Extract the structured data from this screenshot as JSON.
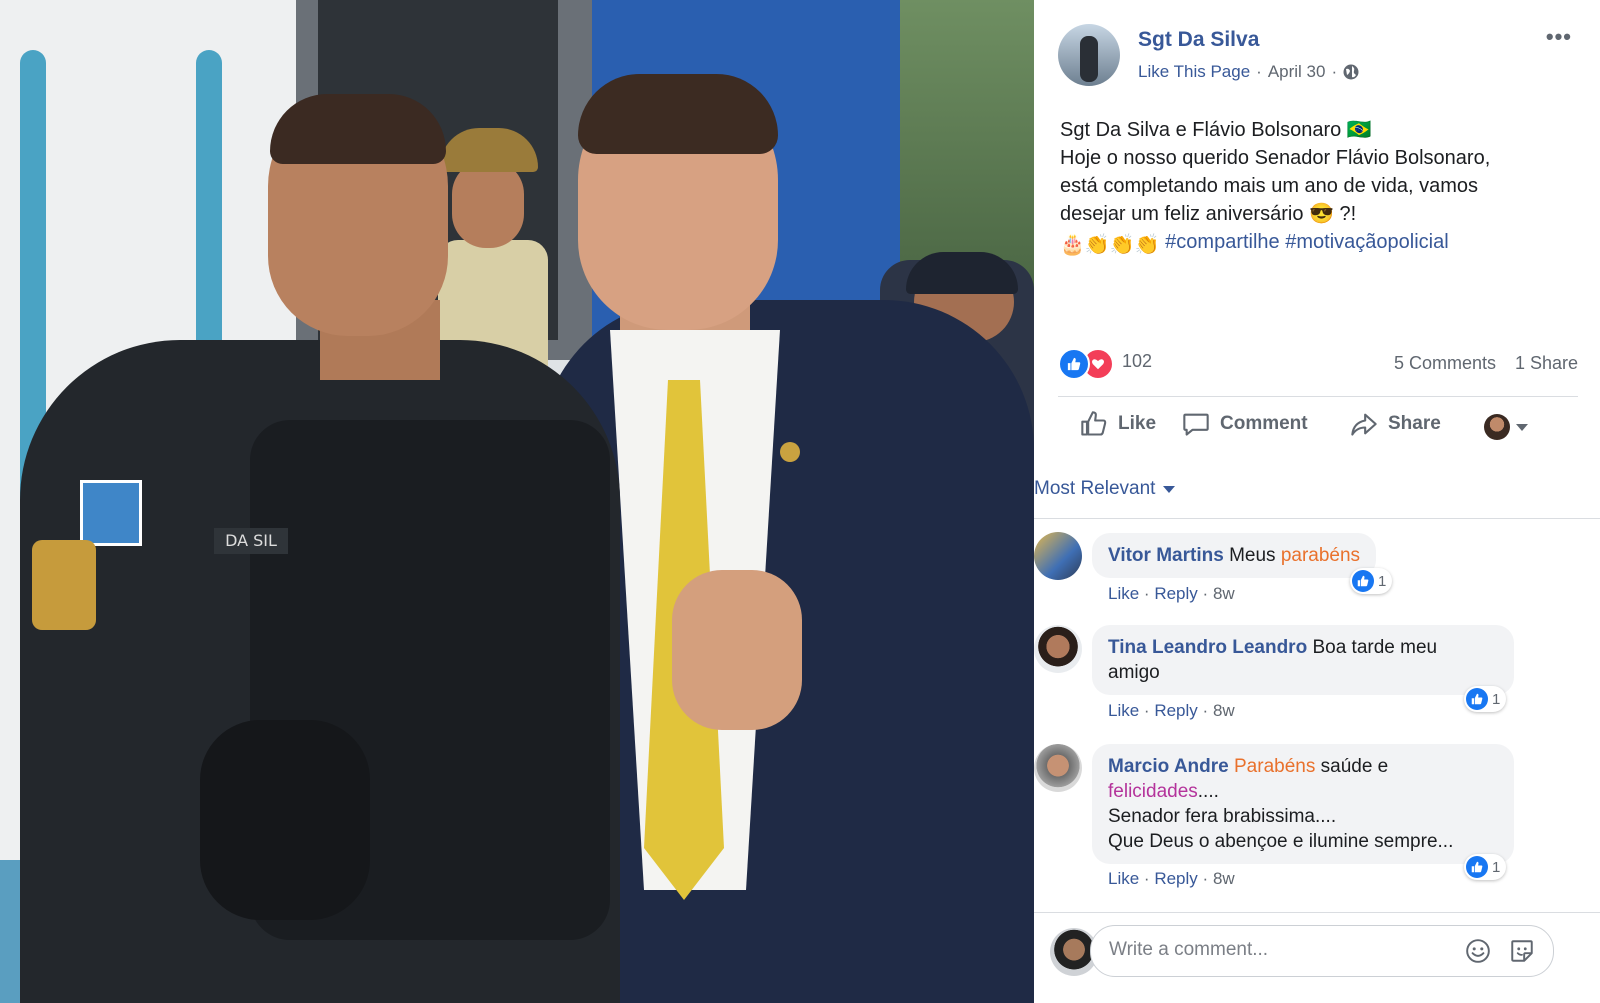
{
  "photo": {
    "nametag": "DA SIL"
  },
  "post": {
    "page_name": "Sgt Da Silva",
    "like_page": "Like This Page",
    "separator": "·",
    "date": "April 30",
    "line1": "Sgt Da Silva e Flávio Bolsonaro 🇧🇷",
    "line2": "Hoje o nosso querido Senador Flávio Bolsonaro,",
    "line3": "está completando mais um ano de vida, vamos",
    "line4": "desejar um feliz aniversário 😎 ?!",
    "emojis": "🎂👏👏👏",
    "hashtag1": "#compartilhe",
    "hashtag2": "#motivaçãopolicial",
    "reaction_count": "102",
    "comments_count": "5 Comments",
    "shares_count": "1 Share"
  },
  "actions": {
    "like": "Like",
    "comment": "Comment",
    "share": "Share"
  },
  "comments_section": {
    "sort_label": "Most Relevant",
    "items": [
      {
        "author": "Vitor Martins",
        "text_a": "Meus ",
        "text_b": "parabéns",
        "reactions": "1",
        "like": "Like",
        "reply": "Reply",
        "dot": "·",
        "age": "8w"
      },
      {
        "author": "Tina Leandro Leandro",
        "text_a": "Boa tarde meu",
        "text_b": "amigo",
        "reactions": "1",
        "like": "Like",
        "reply": "Reply",
        "dot": "·",
        "age": "8w"
      },
      {
        "author": "Marcio Andre",
        "text_a": "Parabéns",
        "text_b": " saúde e",
        "text_c": "felicidades",
        "text_d": "....",
        "text_e": "Senador fera brabissima....",
        "text_f": "Que Deus o abençoe e ilumine sempre...",
        "reactions": "1",
        "like": "Like",
        "reply": "Reply",
        "dot": "·",
        "age": "8w"
      }
    ]
  },
  "composer": {
    "placeholder": "Write a comment..."
  }
}
